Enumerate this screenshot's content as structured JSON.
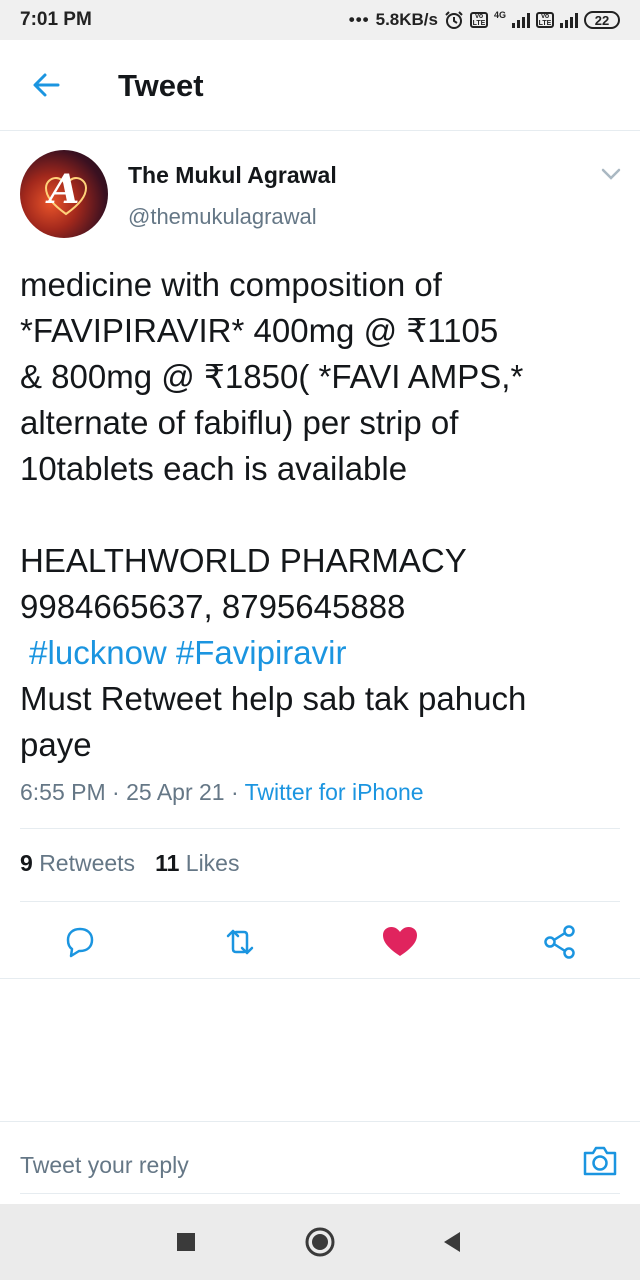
{
  "status_bar": {
    "time": "7:01 PM",
    "net_speed": "5.8KB/s",
    "network_type": "4G",
    "volte_label": "Vo LTE",
    "battery": "22",
    "icons": [
      "alarm-icon",
      "volte-icon",
      "signal-icon",
      "battery-icon"
    ]
  },
  "header": {
    "title": "Tweet",
    "back_icon": "arrow-left-icon"
  },
  "tweet": {
    "author_name": "The Mukul Agrawal",
    "author_handle": "@themukulagrawal",
    "avatar_letter": "A",
    "lines": [
      "medicine with composition of",
      "*FAVIPIRAVIR* 400mg @ ₹1105",
      "& 800mg @ ₹1850( *FAVI AMPS,*",
      "alternate of fabiflu) per strip of",
      "10tablets each is available"
    ],
    "contact_lines": [
      "HEALTHWORLD PHARMACY",
      "9984665637, 8795645888"
    ],
    "hashtags": [
      "#lucknow",
      "#Favipiravir"
    ],
    "closing_lines": [
      "Must Retweet help sab tak pahuch",
      "paye"
    ],
    "time": "6:55 PM",
    "date": "25 Apr 21",
    "source": "Twitter for iPhone",
    "separator": "·"
  },
  "stats": {
    "retweets_count": "9",
    "retweets_label": "Retweets",
    "likes_count": "11",
    "likes_label": "Likes"
  },
  "actions": {
    "icons": [
      "reply-icon",
      "retweet-icon",
      "like-icon",
      "share-icon"
    ],
    "like_color": "#e0245e",
    "icon_color": "#1b95e0"
  },
  "reply": {
    "placeholder": "Tweet your reply",
    "camera_icon": "camera-icon"
  },
  "colors": {
    "accent": "#1b95e0",
    "text": "#14171a",
    "secondary": "#657786",
    "divider": "#e6ecf0"
  },
  "nav": {
    "icons": [
      "square-icon",
      "circle-icon",
      "triangle-back-icon"
    ]
  }
}
